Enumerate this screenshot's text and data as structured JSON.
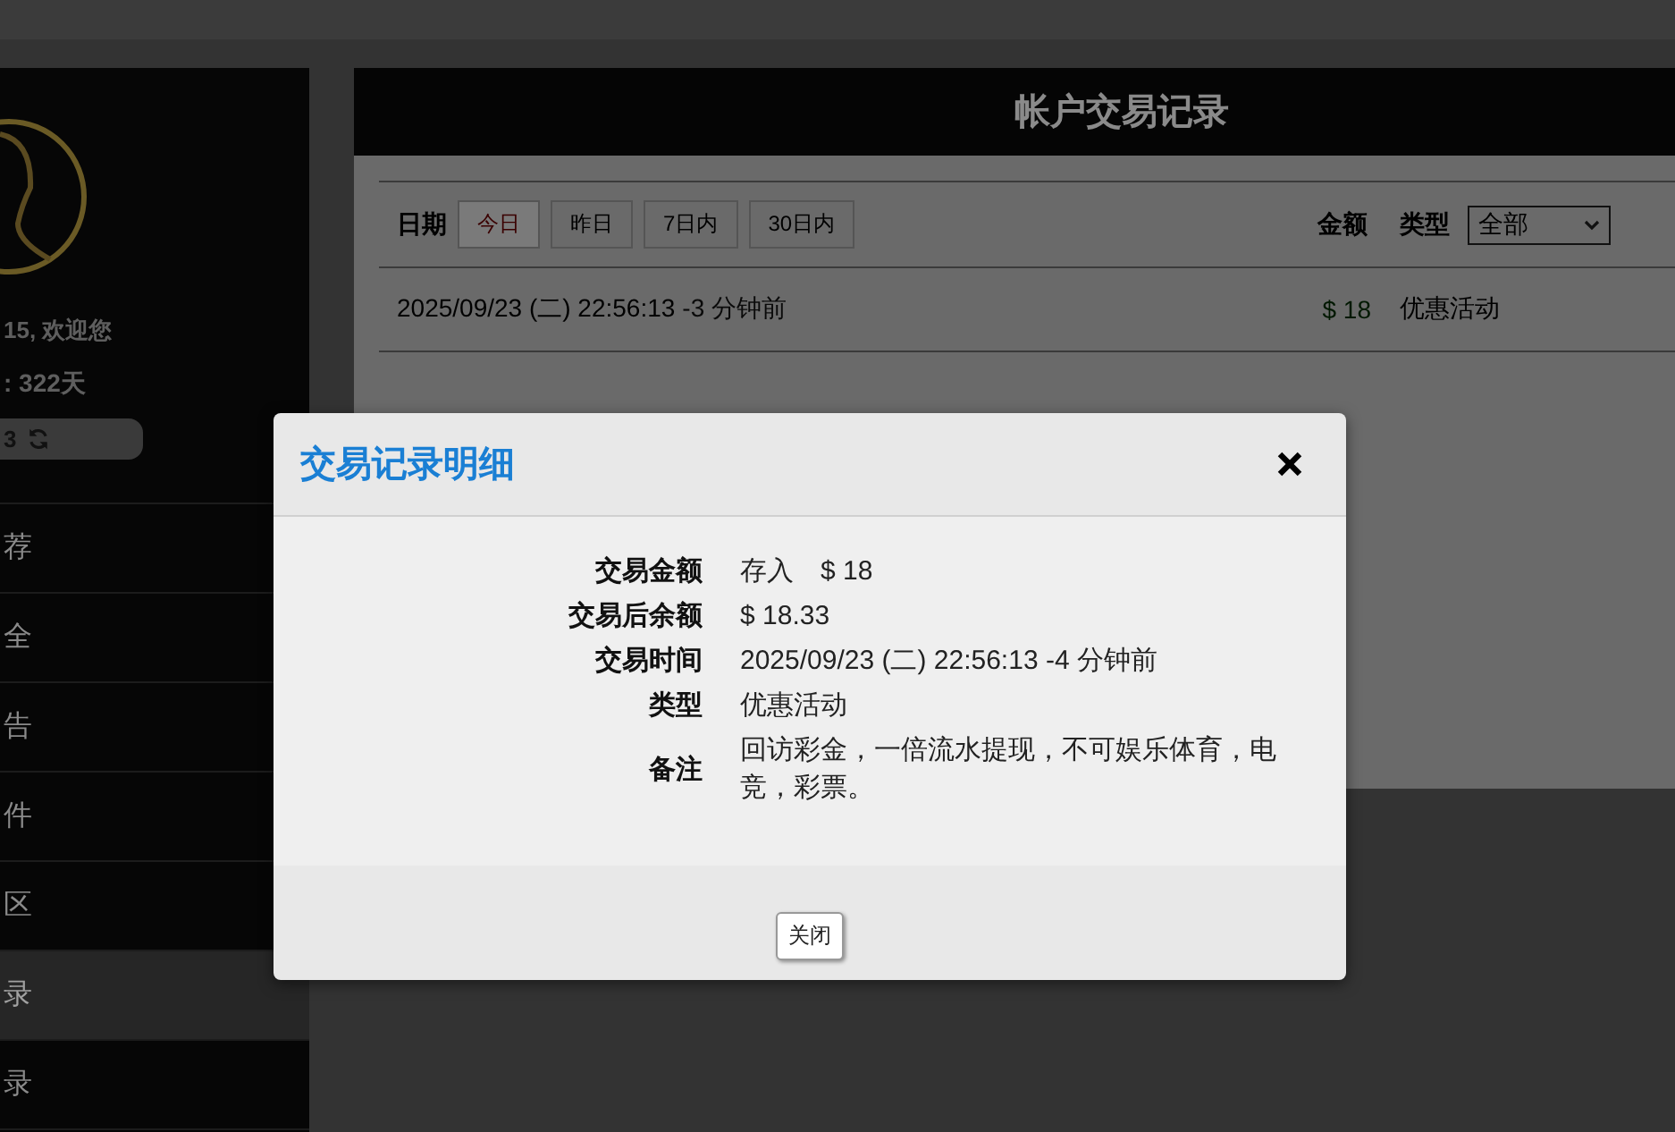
{
  "sidebar": {
    "greeting": "15, 欢迎您",
    "days": ": 322天",
    "balance": "3",
    "menu": [
      {
        "label": "荐",
        "selected": false
      },
      {
        "label": "全",
        "selected": false
      },
      {
        "label": "告",
        "selected": false
      },
      {
        "label": "件",
        "selected": false
      },
      {
        "label": "区",
        "selected": false
      },
      {
        "label": "录",
        "selected": true
      },
      {
        "label": "录",
        "selected": false
      }
    ]
  },
  "panel": {
    "title": "帐户交易记录",
    "date_label": "日期",
    "ranges": [
      {
        "label": "今日",
        "selected": true
      },
      {
        "label": "昨日",
        "selected": false
      },
      {
        "label": "7日内",
        "selected": false
      },
      {
        "label": "30日内",
        "selected": false
      }
    ],
    "amount_label": "金额",
    "type_label": "类型",
    "type_value": "全部",
    "rows": [
      {
        "time": "2025/09/23 (二) 22:56:13",
        "ago": "-3 分钟前",
        "amount": "$ 18",
        "type": "优惠活动"
      }
    ]
  },
  "modal": {
    "title": "交易记录明细",
    "fields": [
      {
        "label": "交易金额",
        "value": "存入　$ 18"
      },
      {
        "label": "交易后余额",
        "value": "$ 18.33"
      },
      {
        "label": "交易时间",
        "value": "2025/09/23 (二) 22:56:13 -4 分钟前"
      },
      {
        "label": "类型",
        "value": "优惠活动"
      },
      {
        "label": "备注",
        "value": "回访彩金，一倍流水提现，不可娱乐体育，电竞，彩票。"
      }
    ],
    "close_button": "关闭"
  }
}
